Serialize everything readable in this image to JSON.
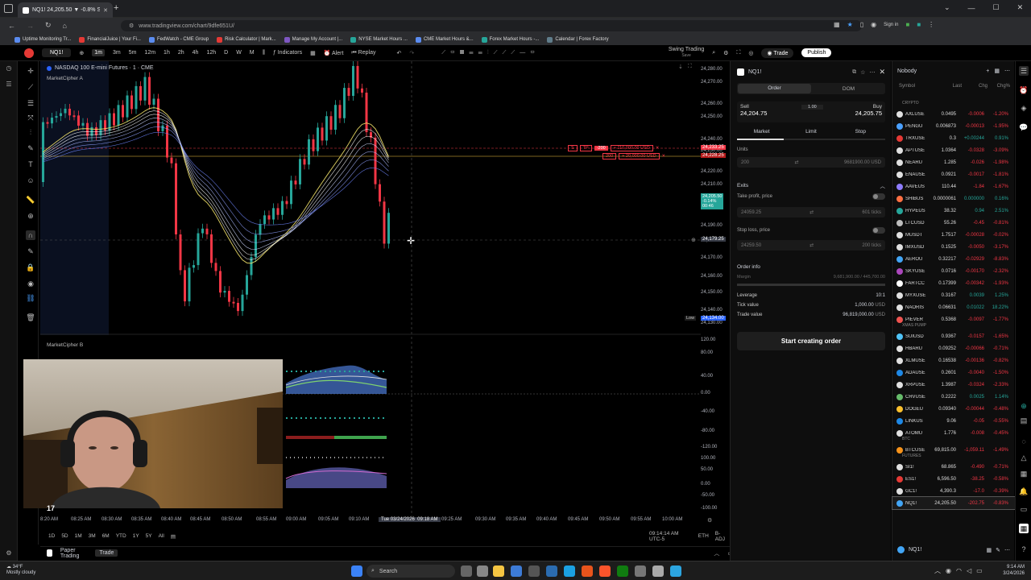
{
  "browser": {
    "tab_title": "NQ1! 24,205.50 ▼ -0.8% Swing",
    "url": "www.tradingview.com/chart/9dfe651U/",
    "bookmarks": [
      "Uptime Monitoring Tr...",
      "FinancialJuice | Your Fi...",
      "FedWatch - CME Group",
      "Risk Calculator | Mark...",
      "Manage My Account |...",
      "NYSE Market Hours ...",
      "CME Market Hours &...",
      "Forex Market Hours -...",
      "Calendar | Forex Factory"
    ],
    "sign_in": "Sign in"
  },
  "toolbar": {
    "symbol": "NQ1!",
    "timeframes": [
      "1m",
      "3m",
      "5m",
      "12m",
      "1h",
      "2h",
      "4h",
      "12h",
      "D",
      "W",
      "M"
    ],
    "active_tf": "1m",
    "indicators": "Indicators",
    "alert": "Alert",
    "replay": "Replay",
    "layout": "Swing Trading",
    "layout_sub": "Save",
    "trade": "Trade",
    "publish": "Publish"
  },
  "chart": {
    "title": "NASDAQ 100 E-mini Futures · 1 · CME",
    "indicator_a": "MarketCipher A",
    "indicator_b": "MarketCipher B",
    "price_labels": [
      "24,280.00",
      "24,270.00",
      "24,260.00",
      "24,250.00",
      "24,240.00",
      "24,230.00",
      "24,220.00",
      "24,210.00",
      "24,200.00",
      "24,190.00",
      "24,180.00",
      "24,170.00",
      "24,160.00",
      "24,150.00",
      "24,140.00",
      "24,130.00"
    ],
    "osc_labels": [
      "120.00",
      "80.00",
      "40.00",
      "0.00",
      "-40.00",
      "-80.00",
      "-120.00",
      "100.00",
      "50.00",
      "0.00",
      "-50.00",
      "-100.00"
    ],
    "time_labels": [
      "8:20 AM",
      "08:25 AM",
      "08:30 AM",
      "08:35 AM",
      "08:40 AM",
      "08:45 AM",
      "08:50 AM",
      "08:55 AM",
      "09:00 AM",
      "09:05 AM",
      "09:10 AM",
      "09:25 AM",
      "09:30 AM",
      "09:35 AM",
      "09:40 AM",
      "09:45 AM",
      "09:50 AM",
      "09:55 AM",
      "10:00 AM"
    ],
    "crosshair_date": "Tue 03/24/2026",
    "crosshair_time": "09:18 AM",
    "crosshair_price": "24,179.25",
    "tp_label": "TP",
    "order_qty": "-200",
    "tp_value": "+ 110,000.00 USD",
    "sl_qty": "200",
    "sl_value": "+ 20,000.00 USD",
    "tag_red1": "24,233.25",
    "tag_red2": "24,228.25",
    "tag_green_price": "24,205.50",
    "tag_green_chg": "-0.14%",
    "tag_green_time": "00:46",
    "low_label": "Low",
    "low_price": "24,134.00",
    "bottom_ranges": [
      "1D",
      "5D",
      "1M",
      "3M",
      "6M",
      "YTD",
      "1Y",
      "5Y",
      "All"
    ],
    "clock": "09:14:14 AM UTC-5",
    "session": "ETH",
    "adj": "B-ADJ",
    "tv_logo": "17"
  },
  "panel_tabs": [
    "Paper Trading",
    "Trade"
  ],
  "order": {
    "symbol": "NQ1!",
    "tabs": [
      "Order",
      "DOM"
    ],
    "sell_label": "Sell",
    "sell_price": "24,204.75",
    "qty": "1.00",
    "buy_label": "Buy",
    "buy_price": "24,205.75",
    "types": [
      "Market",
      "Limit",
      "Stop"
    ],
    "units_label": "Units",
    "units_value": "200",
    "units_usd": "9681900.00 USD",
    "exits_label": "Exits",
    "tp_label": "Take profit, price",
    "tp_value": "24059.25",
    "tp_ticks": "601 ticks",
    "sl_label": "Stop loss, price",
    "sl_value": "24259.50",
    "sl_ticks": "200 ticks",
    "info_label": "Order info",
    "margin_label": "Margin",
    "margin_value": "9,681,900.00 / 445,700.00",
    "leverage_label": "Leverage",
    "leverage_value": "10:1",
    "tick_label": "Tick value",
    "tick_value": "1,000.00",
    "trade_label": "Trade value",
    "trade_value": "96,819,000.00",
    "usd": "USD",
    "cta": "Start creating order"
  },
  "watchlist": {
    "title": "Nobody",
    "cols": [
      "Symbol",
      "Last",
      "Chg",
      "Chg%"
    ],
    "sections": [
      "CRYPTO",
      "XMAS PUMP",
      "BTC",
      "FUTURES"
    ],
    "rows": [
      {
        "sym": "AXLUSE",
        "last": "0.0495",
        "chg": "-0.0006",
        "pct": "-1.20%",
        "color": "#e0e0e0"
      },
      {
        "sym": "PENGU",
        "last": "0.006873",
        "chg": "-0.00013",
        "pct": "-1.95%",
        "color": "#4aa0ff"
      },
      {
        "sym": "TRXUSE",
        "last": "0.3",
        "chg": "+0.00244",
        "pct": "0.91%",
        "color": "#e53935"
      },
      {
        "sym": "APTUSE",
        "last": "1.0364",
        "chg": "-0.0328",
        "pct": "-3.09%",
        "color": "#e0e0e0"
      },
      {
        "sym": "NEARU",
        "last": "1.285",
        "chg": "-0.026",
        "pct": "-1.98%",
        "color": "#e0e0e0"
      },
      {
        "sym": "ENAUSE",
        "last": "0.0921",
        "chg": "-0.0017",
        "pct": "-1.81%",
        "color": "#e0e0e0"
      },
      {
        "sym": "AAVEUS",
        "last": "110.44",
        "chg": "-1.84",
        "pct": "-1.67%",
        "color": "#8e7cff"
      },
      {
        "sym": "SHIBUS",
        "last": "0.0000061",
        "chg": "0.000000",
        "pct": "0.16%",
        "color": "#ff7043"
      },
      {
        "sym": "HYPEUS",
        "last": "38.32",
        "chg": "0.94",
        "pct": "2.51%",
        "color": "#26a69a"
      },
      {
        "sym": "LTCUSD",
        "last": "55.26",
        "chg": "-0.45",
        "pct": "-0.81%",
        "color": "#bdbdbd"
      },
      {
        "sym": "MUSDT",
        "last": "1.7517",
        "chg": "-0.00028",
        "pct": "-0.02%",
        "color": "#e0e0e0"
      },
      {
        "sym": "IMXUSD",
        "last": "0.1525",
        "chg": "-0.0050",
        "pct": "-3.17%",
        "color": "#e0e0e0"
      },
      {
        "sym": "AEROU",
        "last": "0.32217",
        "chg": "-0.02929",
        "pct": "-8.83%",
        "color": "#42a5f5"
      },
      {
        "sym": "SKYUSE",
        "last": "0.0716",
        "chg": "-0.00170",
        "pct": "-2.32%",
        "color": "#ab47bc"
      },
      {
        "sym": "FARTCC",
        "last": "0.17399",
        "chg": "-0.00342",
        "pct": "-1.93%",
        "color": "#ffffff"
      },
      {
        "sym": "MYXUSE",
        "last": "0.3167",
        "chg": "0.0039",
        "pct": "1.25%",
        "color": "#e0e0e0"
      },
      {
        "sym": "NAORIS",
        "last": "0.06631",
        "chg": "0.01022",
        "pct": "18.22%",
        "color": "#e0e0e0"
      },
      {
        "sym": "PIEVER",
        "last": "0.5368",
        "chg": "-0.0097",
        "pct": "-1.77%",
        "color": "#ef5350"
      },
      {
        "sym": "SUIUSD",
        "last": "0.9367",
        "chg": "-0.0157",
        "pct": "-1.65%",
        "color": "#4fc3f7"
      },
      {
        "sym": "HBARU",
        "last": "0.09252",
        "chg": "-0.00066",
        "pct": "-0.71%",
        "color": "#e0e0e0"
      },
      {
        "sym": "XLMUSE",
        "last": "0.16538",
        "chg": "-0.00136",
        "pct": "-0.82%",
        "color": "#e0e0e0"
      },
      {
        "sym": "ADAUSE",
        "last": "0.2601",
        "chg": "-0.0040",
        "pct": "-1.50%",
        "color": "#1e88e5"
      },
      {
        "sym": "XRPUSE",
        "last": "1.3987",
        "chg": "-0.0324",
        "pct": "-2.33%",
        "color": "#e0e0e0"
      },
      {
        "sym": "CRVUSE",
        "last": "0.2222",
        "chg": "0.0025",
        "pct": "1.14%",
        "color": "#66bb6a"
      },
      {
        "sym": "DOGEU",
        "last": "0.09340",
        "chg": "-0.00044",
        "pct": "-0.48%",
        "color": "#fbc02d"
      },
      {
        "sym": "LINKUS",
        "last": "9.06",
        "chg": "-0.05",
        "pct": "-0.55%",
        "color": "#1e88e5"
      },
      {
        "sym": "ATOMU",
        "last": "1.776",
        "chg": "-0.008",
        "pct": "-0.45%",
        "color": "#e0e0e0"
      },
      {
        "sym": "BTCUSE",
        "last": "69,815.00",
        "chg": "-1,059.11",
        "pct": "-1.49%",
        "color": "#f7931a"
      },
      {
        "sym": "SI1!",
        "last": "68.865",
        "chg": "-0.490",
        "pct": "-0.71%",
        "color": "#e0e0e0"
      },
      {
        "sym": "ES1!",
        "last": "6,596.50",
        "chg": "-38.25",
        "pct": "-0.58%",
        "color": "#e53935"
      },
      {
        "sym": "GC1!",
        "last": "4,390.3",
        "chg": "-17.0",
        "pct": "-0.39%",
        "color": "#e0e0e0"
      },
      {
        "sym": "NQ1!",
        "last": "24,205.50",
        "chg": "-202.75",
        "pct": "-0.83%",
        "color": "#42a5f5"
      }
    ],
    "footer_symbol": "NQ1!"
  },
  "taskbar": {
    "weather_temp": "34°F",
    "weather_desc": "Mostly cloudy",
    "search": "Search",
    "time": "9:14 AM",
    "date": "3/24/2026"
  },
  "colors": {
    "up": "#26a69a",
    "down": "#f23645",
    "accent": "#2962ff"
  }
}
